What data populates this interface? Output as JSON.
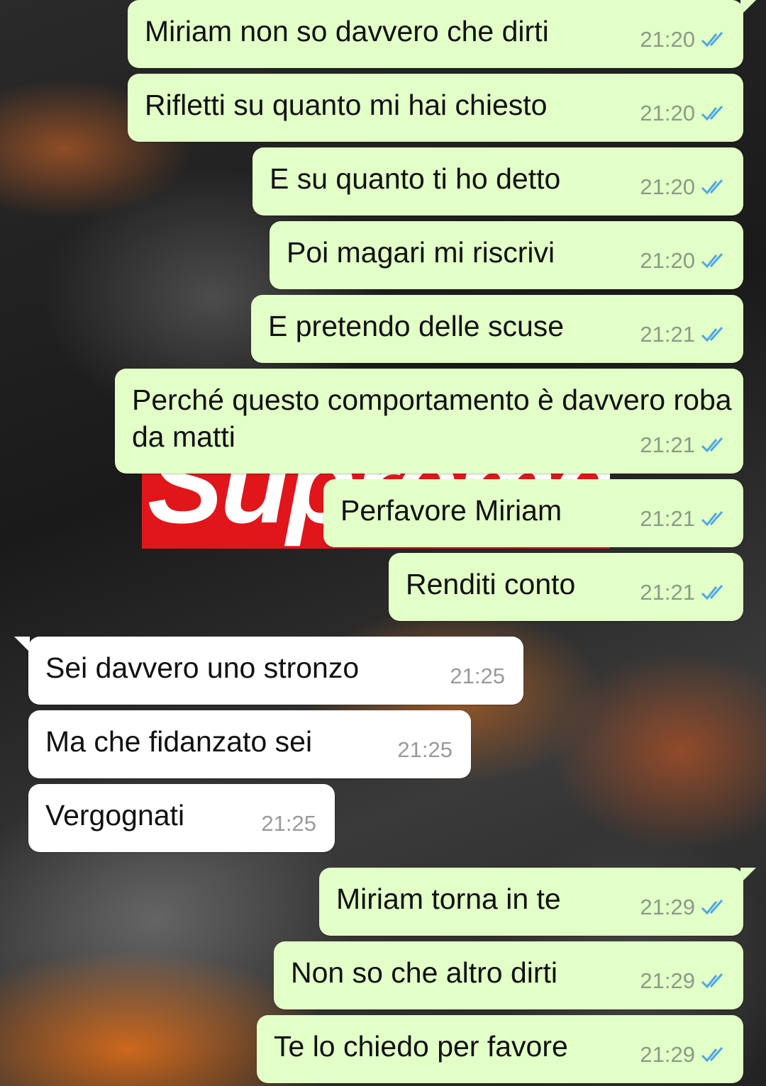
{
  "background": {
    "logo_text": "Supreme",
    "logo_color": "#e0161b"
  },
  "colors": {
    "outgoing_bubble": "#e2ffc7",
    "incoming_bubble": "#ffffff",
    "read_ticks": "#4fa7e6"
  },
  "messages": [
    {
      "text": "Miriam non so davvero che dirti",
      "time": "21:20",
      "direction": "outgoing",
      "status": "read"
    },
    {
      "text": "Rifletti su quanto mi hai chiesto",
      "time": "21:20",
      "direction": "outgoing",
      "status": "read"
    },
    {
      "text": "E su quanto ti ho detto",
      "time": "21:20",
      "direction": "outgoing",
      "status": "read"
    },
    {
      "text": "Poi magari mi riscrivi",
      "time": "21:20",
      "direction": "outgoing",
      "status": "read"
    },
    {
      "text": "E pretendo delle scuse",
      "time": "21:21",
      "direction": "outgoing",
      "status": "read"
    },
    {
      "text": "Perché questo comportamento è davvero roba da matti",
      "time": "21:21",
      "direction": "outgoing",
      "status": "read"
    },
    {
      "text": "Perfavore Miriam",
      "time": "21:21",
      "direction": "outgoing",
      "status": "read"
    },
    {
      "text": "Renditi conto",
      "time": "21:21",
      "direction": "outgoing",
      "status": "read"
    },
    {
      "text": "Sei davvero uno stronzo",
      "time": "21:25",
      "direction": "incoming"
    },
    {
      "text": "Ma che fidanzato sei",
      "time": "21:25",
      "direction": "incoming"
    },
    {
      "text": "Vergognati",
      "time": "21:25",
      "direction": "incoming"
    },
    {
      "text": "Miriam torna in te",
      "time": "21:29",
      "direction": "outgoing",
      "status": "read"
    },
    {
      "text": "Non so che altro dirti",
      "time": "21:29",
      "direction": "outgoing",
      "status": "read"
    },
    {
      "text": "Te lo chiedo per favore",
      "time": "21:29",
      "direction": "outgoing",
      "status": "read"
    }
  ]
}
